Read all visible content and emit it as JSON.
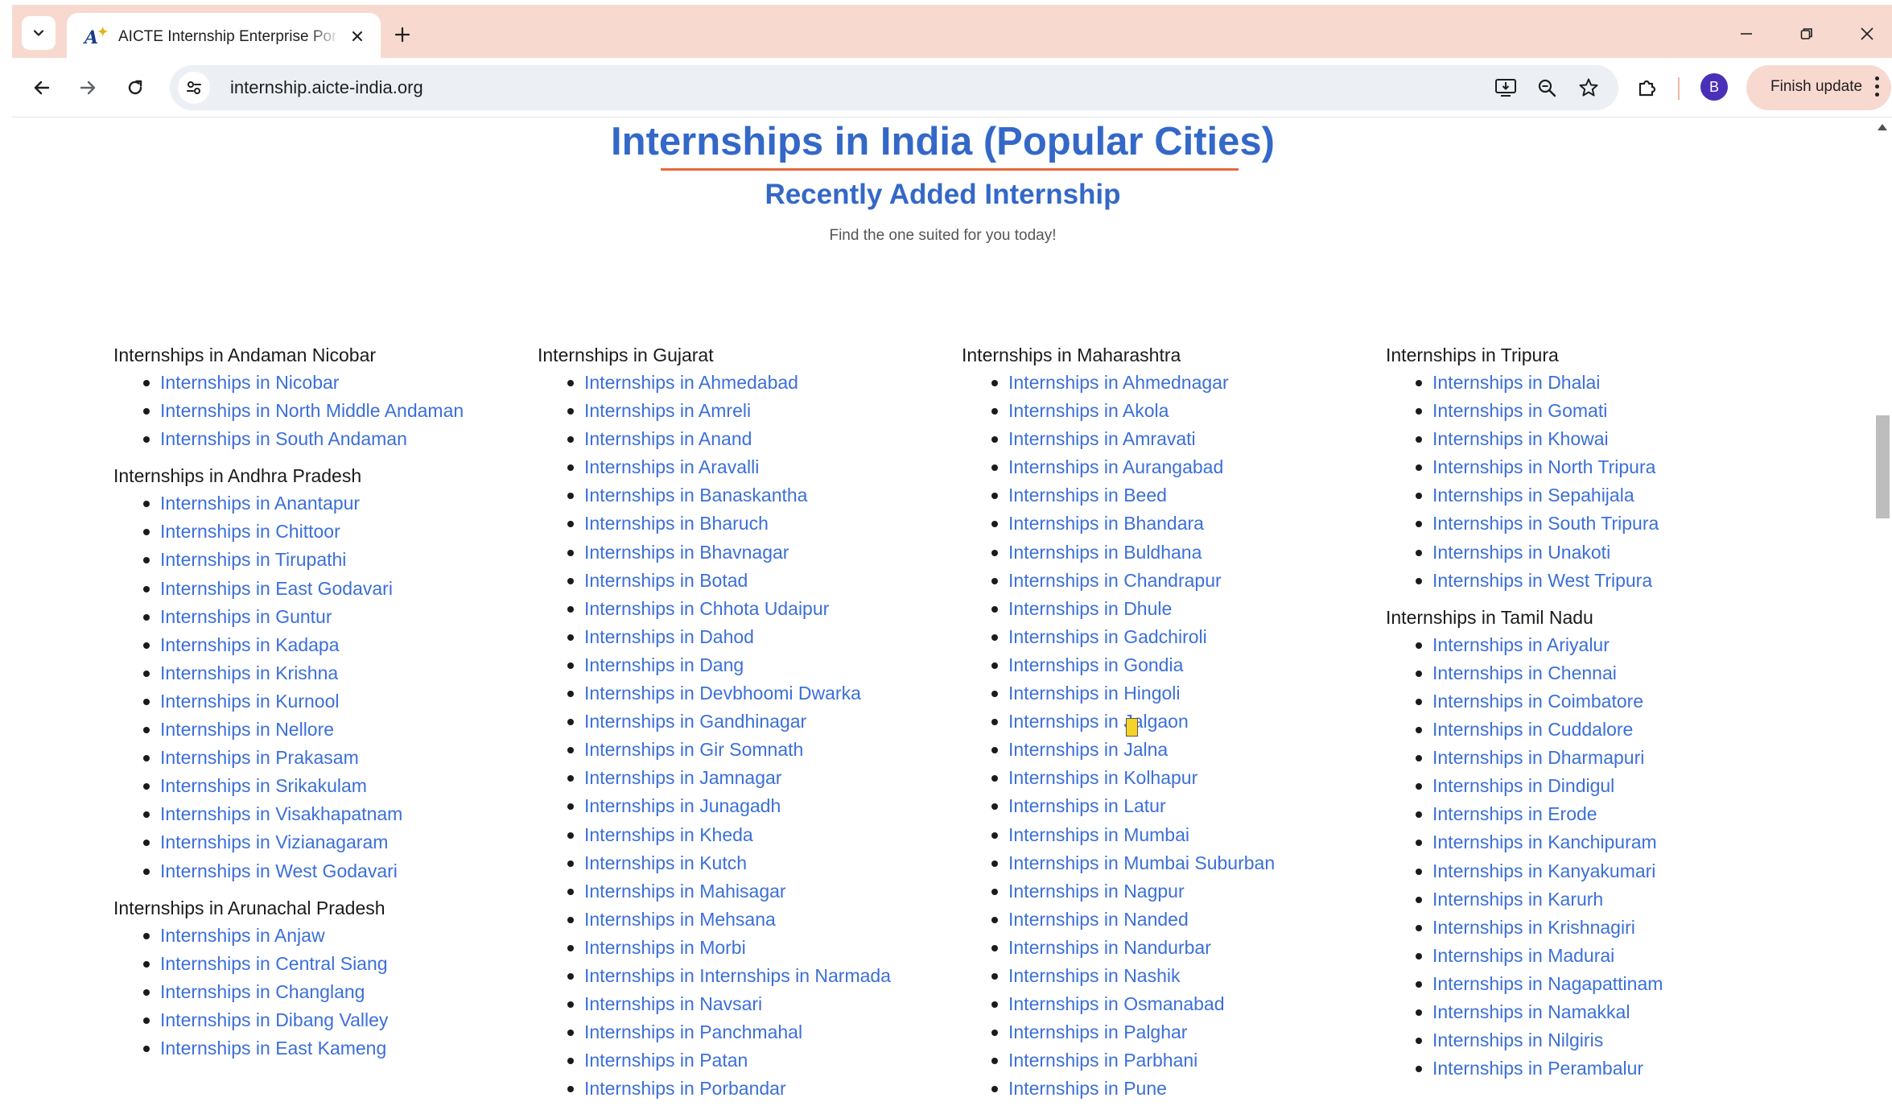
{
  "browser": {
    "tab_title": "AICTE Internship Enterprise Portal",
    "url": "internship.aicte-india.org",
    "finish_update_label": "Finish update",
    "avatar_initial": "B",
    "favicon_text": "A"
  },
  "page": {
    "heading": "Internships in India (Popular Cities)",
    "sub_heading": "Recently Added Internship",
    "tagline": "Find the one suited for you today!"
  },
  "columns": [
    {
      "states": [
        {
          "title": "Internships in Andaman Nicobar",
          "links": [
            "Internships in Nicobar",
            "Internships in North Middle Andaman",
            "Internships in South Andaman"
          ]
        },
        {
          "title": "Internships in Andhra Pradesh",
          "links": [
            "Internships in Anantapur",
            "Internships in Chittoor",
            "Internships in Tirupathi",
            "Internships in East Godavari",
            "Internships in Guntur",
            "Internships in Kadapa",
            "Internships in Krishna",
            "Internships in Kurnool",
            "Internships in Nellore",
            "Internships in Prakasam",
            "Internships in Srikakulam",
            "Internships in Visakhapatnam",
            "Internships in Vizianagaram",
            "Internships in West Godavari"
          ]
        },
        {
          "title": "Internships in Arunachal Pradesh",
          "links": [
            "Internships in Anjaw",
            "Internships in Central Siang",
            "Internships in Changlang",
            "Internships in Dibang Valley",
            "Internships in East Kameng"
          ]
        }
      ]
    },
    {
      "states": [
        {
          "title": "Internships in Gujarat",
          "links": [
            "Internships in Ahmedabad",
            "Internships in Amreli",
            "Internships in Anand",
            "Internships in Aravalli",
            "Internships in Banaskantha",
            "Internships in Bharuch",
            "Internships in Bhavnagar",
            "Internships in Botad",
            "Internships in Chhota Udaipur",
            "Internships in Dahod",
            "Internships in Dang",
            "Internships in Devbhoomi Dwarka",
            "Internships in Gandhinagar",
            "Internships in Gir Somnath",
            "Internships in Jamnagar",
            "Internships in Junagadh",
            "Internships in Kheda",
            "Internships in Kutch",
            "Internships in Mahisagar",
            "Internships in Mehsana",
            "Internships in Morbi",
            "Internships in Internships in Narmada",
            "Internships in Navsari",
            "Internships in Panchmahal",
            "Internships in Patan",
            "Internships in Porbandar"
          ]
        }
      ]
    },
    {
      "states": [
        {
          "title": "Internships in Maharashtra",
          "links": [
            "Internships in Ahmednagar",
            "Internships in Akola",
            "Internships in Amravati",
            "Internships in Aurangabad",
            "Internships in Beed",
            "Internships in Bhandara",
            "Internships in Buldhana",
            "Internships in Chandrapur",
            "Internships in Dhule",
            "Internships in Gadchiroli",
            "Internships in Gondia",
            "Internships in Hingoli",
            "Internships in Jalgaon",
            "Internships in Jalna",
            "Internships in Kolhapur",
            "Internships in Latur",
            "Internships in Mumbai",
            "Internships in Mumbai Suburban",
            "Internships in Nagpur",
            "Internships in Nanded",
            "Internships in Nandurbar",
            "Internships in Nashik",
            "Internships in Osmanabad",
            "Internships in Palghar",
            "Internships in Parbhani",
            "Internships in Pune"
          ]
        }
      ]
    },
    {
      "states": [
        {
          "title": "Internships in Tripura",
          "links": [
            "Internships in Dhalai",
            "Internships in Gomati",
            "Internships in Khowai",
            "Internships in North Tripura",
            "Internships in Sepahijala",
            "Internships in South Tripura",
            "Internships in Unakoti",
            "Internships in West Tripura"
          ]
        },
        {
          "title": "Internships in Tamil Nadu",
          "links": [
            "Internships in Ariyalur",
            "Internships in Chennai",
            "Internships in Coimbatore",
            "Internships in Cuddalore",
            "Internships in Dharmapuri",
            "Internships in Dindigul",
            "Internships in Erode",
            "Internships in Kanchipuram",
            "Internships in Kanyakumari",
            "Internships in Karurh",
            "Internships in Krishnagiri",
            "Internships in Madurai",
            "Internships in Nagapattinam",
            "Internships in Namakkal",
            "Internships in Nilgiris",
            "Internships in Perambalur"
          ]
        }
      ]
    }
  ],
  "colors": {
    "heading_blue": "#3468c8",
    "link_blue": "#3b6fd8",
    "rule_orange": "#e46a3a",
    "chrome_peach": "#f8d9cf"
  }
}
